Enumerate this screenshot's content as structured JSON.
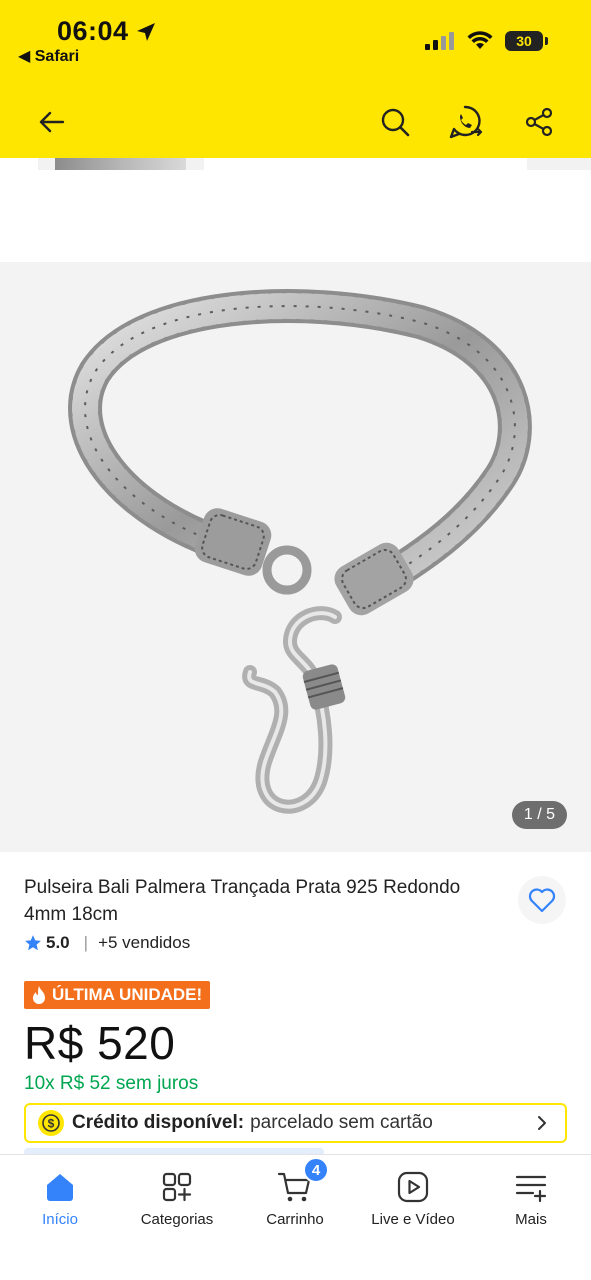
{
  "status_bar": {
    "time": "06:04",
    "back_app": "◀ Safari",
    "battery": "30"
  },
  "header": {
    "back_icon": "arrow-left-icon",
    "search_icon": "search-icon",
    "whatsapp_icon": "whatsapp-icon",
    "share_icon": "share-icon"
  },
  "gallery": {
    "pager": "1 / 5"
  },
  "product": {
    "title": "Pulseira Bali Palmera Trançada Prata 925 Redondo 4mm 18cm",
    "rating": "5.0",
    "sold": "+5 vendidos",
    "badge": "ÚLTIMA UNIDADE!",
    "price": "R$ 520",
    "installments": "10x R$ 52 sem juros",
    "credit_label": "Crédito disponível:",
    "credit_value": "parcelado sem cartão"
  },
  "bottom_nav": {
    "items": [
      {
        "label": "Início",
        "icon": "home-icon"
      },
      {
        "label": "Categorias",
        "icon": "categories-icon"
      },
      {
        "label": "Carrinho",
        "icon": "cart-icon",
        "badge": "4"
      },
      {
        "label": "Live e Vídeo",
        "icon": "play-icon"
      },
      {
        "label": "Mais",
        "icon": "menu-plus-icon"
      }
    ]
  },
  "colors": {
    "brand_yellow": "#ffe600",
    "accent_blue": "#3483fa",
    "green": "#00a650",
    "badge_orange": "#f46f1b"
  }
}
